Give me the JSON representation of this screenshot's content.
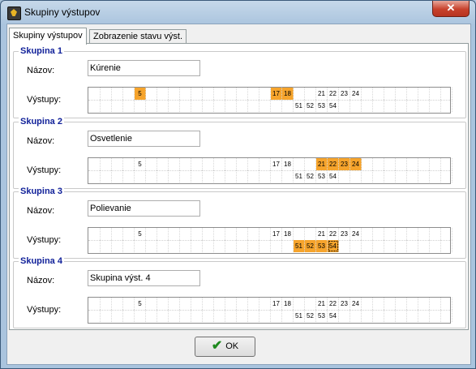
{
  "window": {
    "title": "Skupiny výstupov",
    "close_label": "✕"
  },
  "tabs": [
    {
      "label": "Skupiny výstupov",
      "active": true
    },
    {
      "label": "Zobrazenie stavu výst.",
      "active": false
    }
  ],
  "labels": {
    "name": "Názov:",
    "outputs": "Výstupy:"
  },
  "groups": [
    {
      "title": "Skupina 1",
      "name": "Kúrenie",
      "selected": [
        5,
        17,
        18
      ],
      "focus": null
    },
    {
      "title": "Skupina 2",
      "name": "Osvetlenie",
      "selected": [
        21,
        22,
        23,
        24
      ],
      "focus": null
    },
    {
      "title": "Skupina 3",
      "name": "Polievanie",
      "selected": [
        51,
        52,
        53,
        54
      ],
      "focus": 54
    },
    {
      "title": "Skupina 4",
      "name": "Skupina výst. 4",
      "selected": [],
      "focus": null
    }
  ],
  "output_numbers_shown": {
    "row1": [
      5,
      17,
      18,
      21,
      22,
      23,
      24
    ],
    "row2": [
      51,
      52,
      53,
      54
    ]
  },
  "ok_label": "OK",
  "colors": {
    "selected": "#f6a42c",
    "group_title": "#12229a"
  }
}
